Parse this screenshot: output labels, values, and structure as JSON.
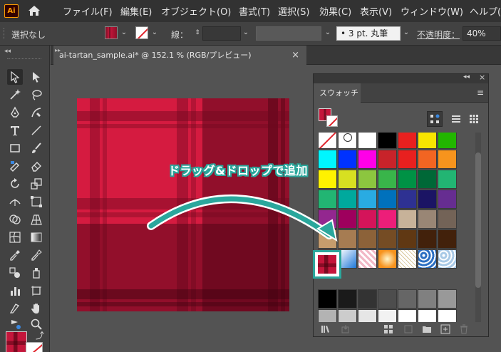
{
  "app": {
    "logo_text": "Ai",
    "brand_color": "#ff9a00"
  },
  "menu": {
    "items": [
      "ファイル(F)",
      "編集(E)",
      "オブジェクト(O)",
      "書式(T)",
      "選択(S)",
      "効果(C)",
      "表示(V)",
      "ウィンドウ(W)",
      "ヘルプ("
    ]
  },
  "control_bar": {
    "selection_label": "選択なし",
    "stroke_label": "線：",
    "brush_value": "3 pt. 丸筆",
    "opacity_label": "不透明度：",
    "opacity_value": "40%"
  },
  "document": {
    "tab_title": "ai-tartan_sample.ai* @ 152.1 % (RGB/プレビュー)",
    "close_glyph": "×"
  },
  "swatches_panel": {
    "title": "スウォッチ",
    "collapse_glyph": "◂◂",
    "close_glyph": "×",
    "menu_glyph": "≡",
    "rows": [
      [
        "#ffffff",
        "#ffffff",
        "#ffffff",
        "#000000",
        "#e8201f",
        "#f7e500",
        "#22b600"
      ],
      [
        "#00f6ff",
        "#0032ff",
        "#ff00e8",
        "#c8232a",
        "#e8201f",
        "#f26522",
        "#f7941d"
      ],
      [
        "#fff200",
        "#d7e021",
        "#8cc63f",
        "#39b54a",
        "#009245",
        "#006837",
        "#22b573"
      ],
      [
        "#22b573",
        "#00a99d",
        "#29abe2",
        "#0071bc",
        "#2e3192",
        "#1b1464",
        "#662d91"
      ],
      [
        "#93278f",
        "#9e005d",
        "#d4145a",
        "#ed1e79",
        "#c7b299",
        "#998675",
        "#736357"
      ],
      [
        "#c69c6d",
        "#a67c52",
        "#8c6239",
        "#754c24",
        "#603813",
        "#42210b",
        "#42210b"
      ],
      [
        "#000000",
        "#1a1a1a",
        "#333333",
        "#4d4d4d",
        "#666666",
        "#808080",
        "#999999"
      ],
      [
        "#b3b3b3",
        "#cccccc",
        "#e6e6e6",
        "#f2f2f2",
        "#ffffff",
        "#ffffff",
        "#ffffff"
      ]
    ],
    "pattern_colors": [
      "#ffffff",
      "#1f77d9",
      "#f2b8c6",
      "#f7931e",
      "#d9c79b",
      "#2c6fc2",
      "#a8c9e6"
    ],
    "added_swatch_color": "#c4163b"
  },
  "annotation": {
    "text": "ドラッグ&ドロップで追加",
    "color": "#2aa79c"
  },
  "tartan": {
    "base": "#d51b40",
    "dark": "#8a0f27",
    "darker": "#6a0b1e",
    "darkest": "#4a0515"
  }
}
